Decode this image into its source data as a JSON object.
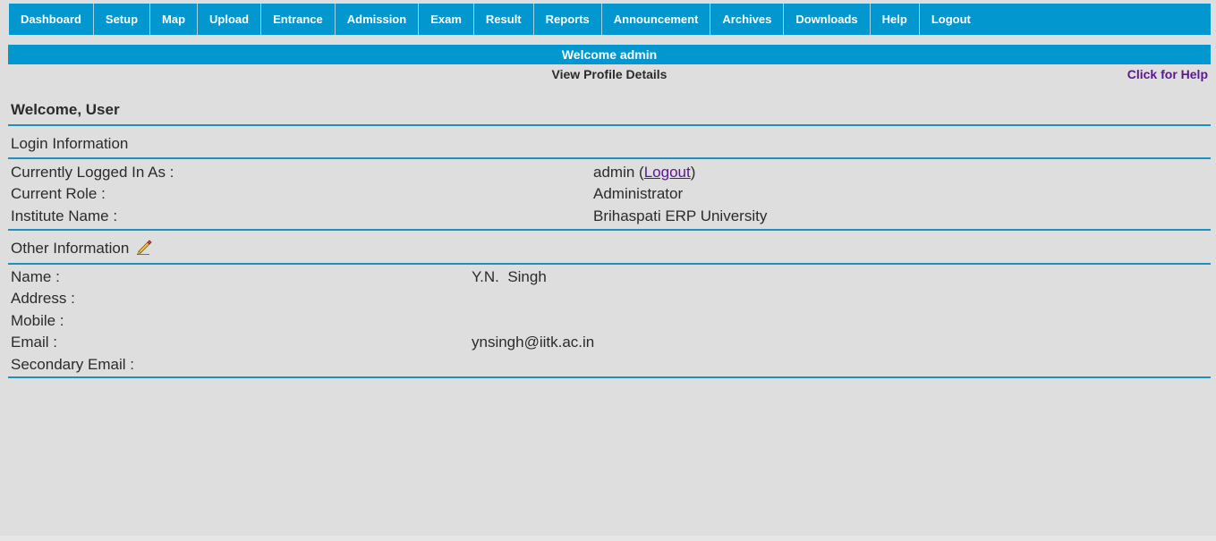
{
  "nav": {
    "items": [
      "Dashboard",
      "Setup",
      "Map",
      "Upload",
      "Entrance",
      "Admission",
      "Exam",
      "Result",
      "Reports",
      "Announcement",
      "Archives",
      "Downloads",
      "Help",
      "Logout"
    ]
  },
  "header": {
    "welcome": "Welcome admin",
    "profile_link": "View Profile Details",
    "help_link": "Click for Help"
  },
  "main": {
    "greeting": "Welcome, User",
    "login_section": {
      "title": "Login Information",
      "logged_label": "Currently Logged In As :",
      "logged_user": "admin",
      "logout_link": "Logout",
      "role_label": "Current Role :",
      "role_value": "Administrator",
      "institute_label": "Institute Name :",
      "institute_value": "Brihaspati ERP University"
    },
    "other_section": {
      "title": "Other Information",
      "edit_icon": "pencil-icon",
      "name_label": "Name :",
      "name_value": "Y.N.  Singh",
      "address_label": "Address :",
      "mobile_label": "Mobile :",
      "email_label": "Email :",
      "email_value": "ynsingh@iitk.ac.in",
      "secondary_email_label": "Secondary Email :"
    }
  },
  "colors": {
    "accent": "#0397cf",
    "link": "#5b1792",
    "background": "#dedede"
  }
}
